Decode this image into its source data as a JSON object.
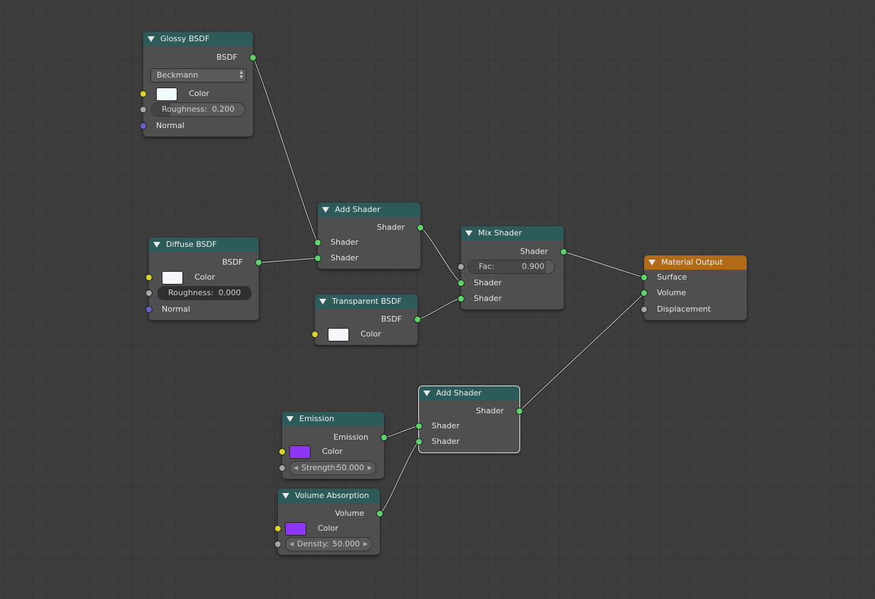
{
  "nodes": {
    "glossy": {
      "title": "Glossy BSDF",
      "out": "BSDF",
      "distribution": "Beckmann",
      "color_label": "Color",
      "color": "#f2fbfc",
      "rough_label": "Roughness:",
      "rough_value": "0.200",
      "normal": "Normal"
    },
    "diffuse": {
      "title": "Diffuse BSDF",
      "out": "BSDF",
      "color_label": "Color",
      "color": "#f7f7fb",
      "rough_label": "Roughness:",
      "rough_value": "0.000",
      "normal": "Normal"
    },
    "add1": {
      "title": "Add Shader",
      "out": "Shader",
      "in1": "Shader",
      "in2": "Shader"
    },
    "transparent": {
      "title": "Transparent BSDF",
      "out": "BSDF",
      "color_label": "Color",
      "color": "#f8f5fb"
    },
    "mix": {
      "title": "Mix Shader",
      "out": "Shader",
      "fac_label": "Fac:",
      "fac_value": "0.900",
      "fac_fraction": 0.9,
      "in1": "Shader",
      "in2": "Shader"
    },
    "output": {
      "title": "Material Output",
      "surface": "Surface",
      "volume": "Volume",
      "displacement": "Displacement"
    },
    "add2": {
      "title": "Add Shader",
      "out": "Shader",
      "in1": "Shader",
      "in2": "Shader"
    },
    "emission": {
      "title": "Emission",
      "out": "Emission",
      "color_label": "Color",
      "color": "#8c35f5",
      "strength_label": "Strength:",
      "strength_value": "50.000"
    },
    "volume": {
      "title": "Volume Absorption",
      "out": "Volume",
      "color_label": "Color",
      "color": "#8c35f5",
      "density_label": "Density:",
      "density_value": "50.000"
    }
  },
  "colors": {
    "header": "#2d5b5a",
    "output_header": "#b06a18",
    "socket_shader": "#5fd36b",
    "socket_color": "#d8d12f",
    "socket_value": "#a5a5a5",
    "socket_vector": "#6363cc"
  }
}
